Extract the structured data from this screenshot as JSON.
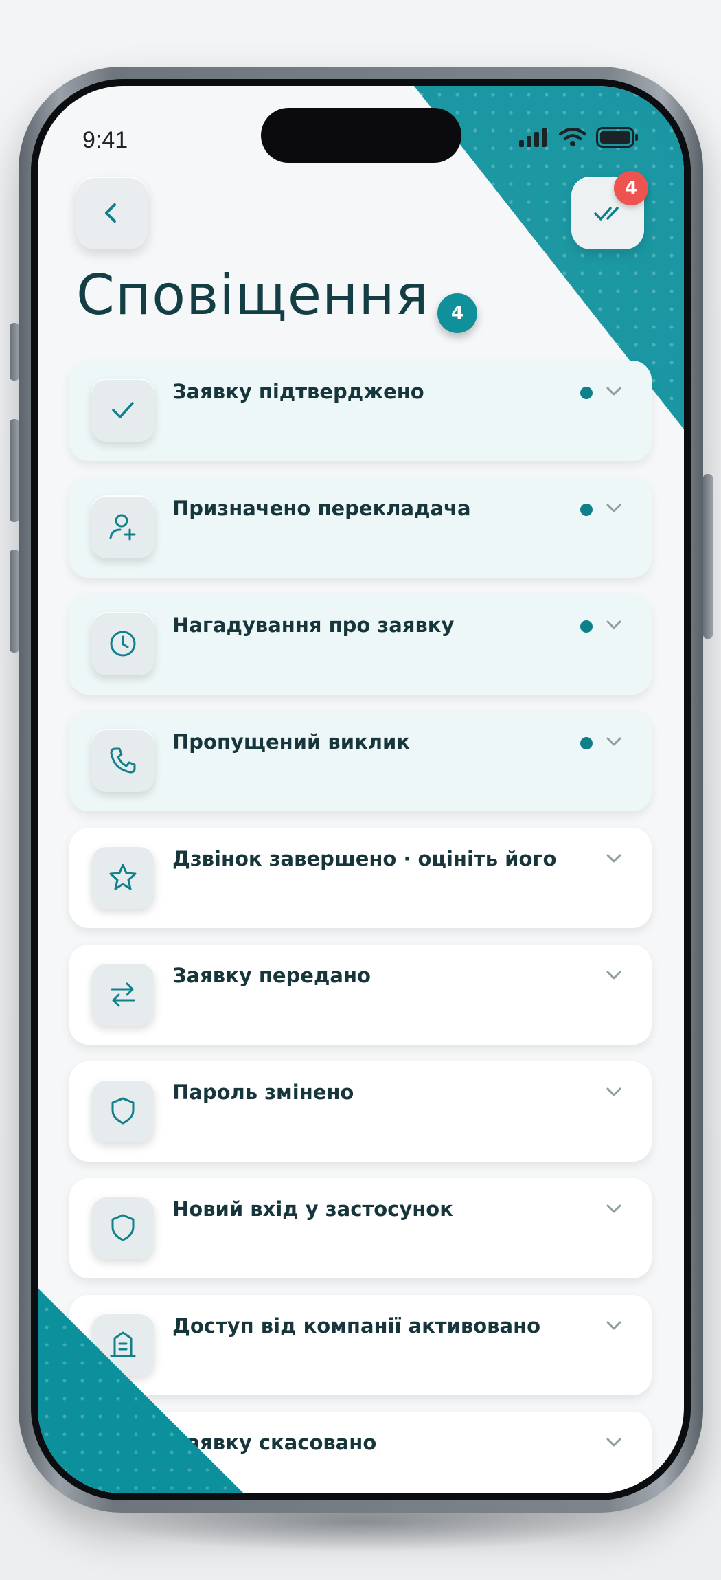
{
  "status_bar": {
    "time": "9:41"
  },
  "header": {
    "title": "Сповіщення",
    "title_badge": "4",
    "mark_all_badge": "4"
  },
  "colors": {
    "accent": "#0b909c",
    "unread_dot": "#0f7f8a",
    "badge_red": "#ef5350",
    "title": "#123e44"
  },
  "notifications": [
    {
      "label": "Заявку підтверджено",
      "icon": "check-icon",
      "unread": true
    },
    {
      "label": "Призначено перекладача",
      "icon": "user-add-icon",
      "unread": true
    },
    {
      "label": "Нагадування про заявку",
      "icon": "clock-icon",
      "unread": true
    },
    {
      "label": "Пропущений виклик",
      "icon": "phone-icon",
      "unread": true
    },
    {
      "label": "Дзвінок завершено · оцініть його",
      "icon": "star-icon",
      "unread": false
    },
    {
      "label": "Заявку передано",
      "icon": "transfer-arrows-icon",
      "unread": false
    },
    {
      "label": "Пароль змінено",
      "icon": "shield-icon",
      "unread": false
    },
    {
      "label": "Новий вхід у застосунок",
      "icon": "shield-icon",
      "unread": false
    },
    {
      "label": "Доступ від компанії активовано",
      "icon": "building-icon",
      "unread": false
    },
    {
      "label": "Заявку скасовано",
      "icon": "cancel-icon",
      "unread": false
    }
  ]
}
